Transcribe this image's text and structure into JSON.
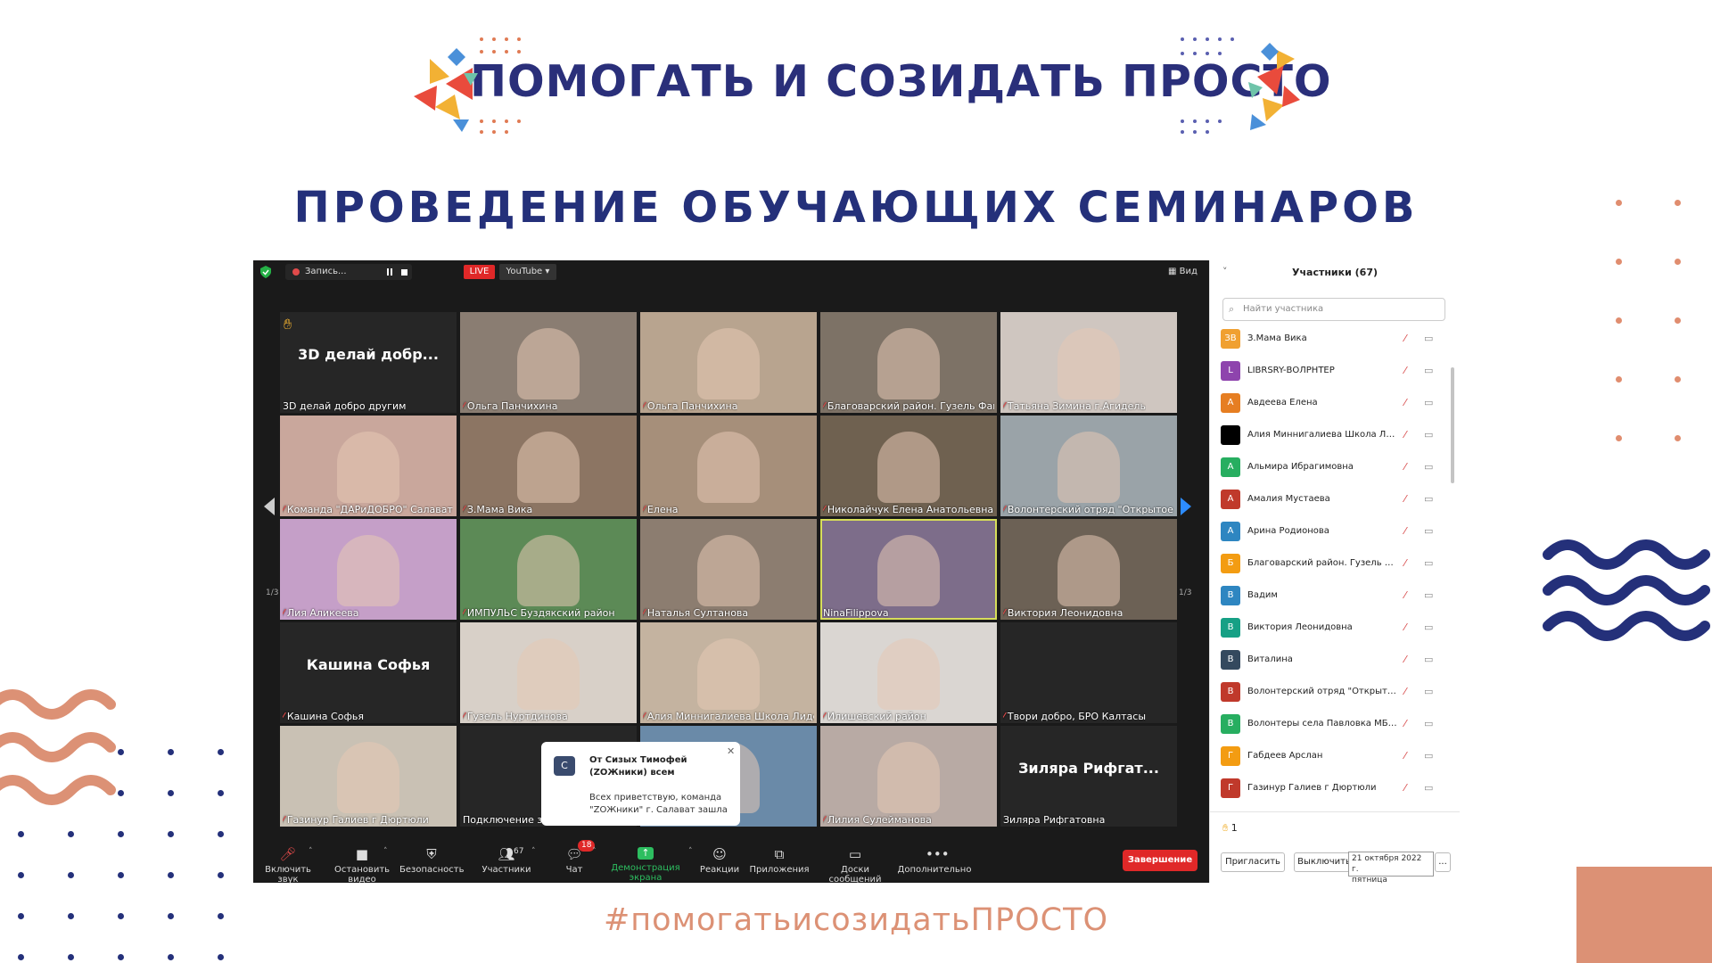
{
  "banner": {
    "title": "ПОМОГАТЬ И СОЗИДАТЬ ПРОСТО",
    "subtitle": "ПРОВЕДЕНИЕ ОБУЧАЮЩИХ СЕМИНАРОВ",
    "hashtag": "#помогатьисозидатьПРОСТО"
  },
  "zoom": {
    "recording_label": "Запись...",
    "live_label": "LIVE",
    "stream_target": "YouTube",
    "view_label": "Вид",
    "page_left": "1/3",
    "page_right": "1/3",
    "tiles": [
      {
        "name": "3D делай добро другим",
        "big": "3D делай добр...",
        "muted": false,
        "hand": true
      },
      {
        "name": "Ольга Панчихина",
        "muted": true
      },
      {
        "name": "Ольга Панчихина",
        "muted": true
      },
      {
        "name": "Благоварский район. Гузель Фан...",
        "muted": true
      },
      {
        "name": "Татьяна Зимина г.Агидель",
        "muted": true
      },
      {
        "name": "Команда \"ДАРиДОБРО\" Салават",
        "muted": true
      },
      {
        "name": "З.Мама Вика",
        "muted": true
      },
      {
        "name": "Елена",
        "muted": true
      },
      {
        "name": "Николайчук Елена Анатольевна ...",
        "muted": true
      },
      {
        "name": "Волонтерский отряд \"Открытое с...",
        "muted": true
      },
      {
        "name": "Лия Аликеева",
        "muted": true
      },
      {
        "name": "ИМПУЛЬС Буздякский район",
        "muted": true
      },
      {
        "name": "Наталья Султанова",
        "muted": true
      },
      {
        "name": "NinaFilippova",
        "muted": false
      },
      {
        "name": "Виктория Леонидовна",
        "muted": true
      },
      {
        "name": "Кашина Софья",
        "big": "Кашина Софья",
        "muted": true
      },
      {
        "name": "Гузель Нуртдинова",
        "muted": true
      },
      {
        "name": "Алия Миннигалиева Школа Лиде...",
        "muted": true
      },
      {
        "name": "Илишевский район",
        "muted": true
      },
      {
        "name": "Твори добро, БРО  Калтасы",
        "muted": true
      },
      {
        "name": "Газинур Галиев г Дюртюли",
        "muted": true
      },
      {
        "name": "Подключение зв...",
        "muted": false
      },
      {
        "name": "",
        "muted": false
      },
      {
        "name": "Лилия Сулейманова",
        "muted": true
      },
      {
        "name": "Зиляра Рифгатовна",
        "big": "Зиляра Рифгат...",
        "muted": false
      }
    ],
    "chat_popup": {
      "avatar": "С",
      "from": "От Сизых Тимофей (ZОЖники) всем",
      "message": "Всех приветствую, команда \"ZОЖники\" г. Салават зашла"
    },
    "toolbar": {
      "unmute": "Включить звук",
      "stop_video": "Остановить видео",
      "security": "Безопасность",
      "participants": "Участники",
      "participants_count": "67",
      "chat": "Чат",
      "chat_badge": "18",
      "share": "Демонстрация экрана",
      "reactions": "Реакции",
      "apps": "Приложения",
      "whiteboards": "Доски сообщений",
      "more": "Дополнительно",
      "end": "Завершение"
    }
  },
  "participants_panel": {
    "title": "Участники (67)",
    "search_placeholder": "Найти участника",
    "items": [
      {
        "initials": "ЗВ",
        "name": "З.Мама Вика",
        "color": "#f0a030"
      },
      {
        "initials": "L",
        "name": "LIBRSRY-ВОЛРНТЕР",
        "color": "#8e44ad"
      },
      {
        "initials": "А",
        "name": "Авдеева Елена",
        "color": "#e67e22"
      },
      {
        "initials": "",
        "name": "Алия Миннигалиева Школа Лид...",
        "color": "#000000"
      },
      {
        "initials": "А",
        "name": "Альмира Ибрагимовна",
        "color": "#27ae60"
      },
      {
        "initials": "А",
        "name": "Амалия Мустаева",
        "color": "#c0392b"
      },
      {
        "initials": "А",
        "name": "Арина Родионова",
        "color": "#2e86c1"
      },
      {
        "initials": "Б",
        "name": "Благоварский район. Гузель Фа...",
        "color": "#f39c12"
      },
      {
        "initials": "В",
        "name": "Вадим",
        "color": "#2e86c1"
      },
      {
        "initials": "В",
        "name": "Виктория Леонидовна",
        "color": "#16a085"
      },
      {
        "initials": "В",
        "name": "Виталина",
        "color": "#34495e"
      },
      {
        "initials": "В",
        "name": "Волонтерский отряд \"Открытое...",
        "color": "#c0392b"
      },
      {
        "initials": "В",
        "name": "Волонтеры села Павловка МБО...",
        "color": "#27ae60"
      },
      {
        "initials": "Г",
        "name": "Габдеев Арслан",
        "color": "#f39c12"
      },
      {
        "initials": "Г",
        "name": "Газинур Галиев г Дюртюли",
        "color": "#c0392b"
      }
    ],
    "raised_hands": "1",
    "invite_label": "Пригласить",
    "mute_all_label": "Выключить",
    "date_tooltip_line1": "21 октября 2022 г.",
    "date_tooltip_line2": "пятница",
    "more_label": "..."
  },
  "colors": {
    "title_navy": "#2a2f7a",
    "hashtag_salmon": "#dc9175",
    "zoom_bg": "#1a1a1a",
    "end_red": "#e02828",
    "share_green": "#2dbe60"
  }
}
